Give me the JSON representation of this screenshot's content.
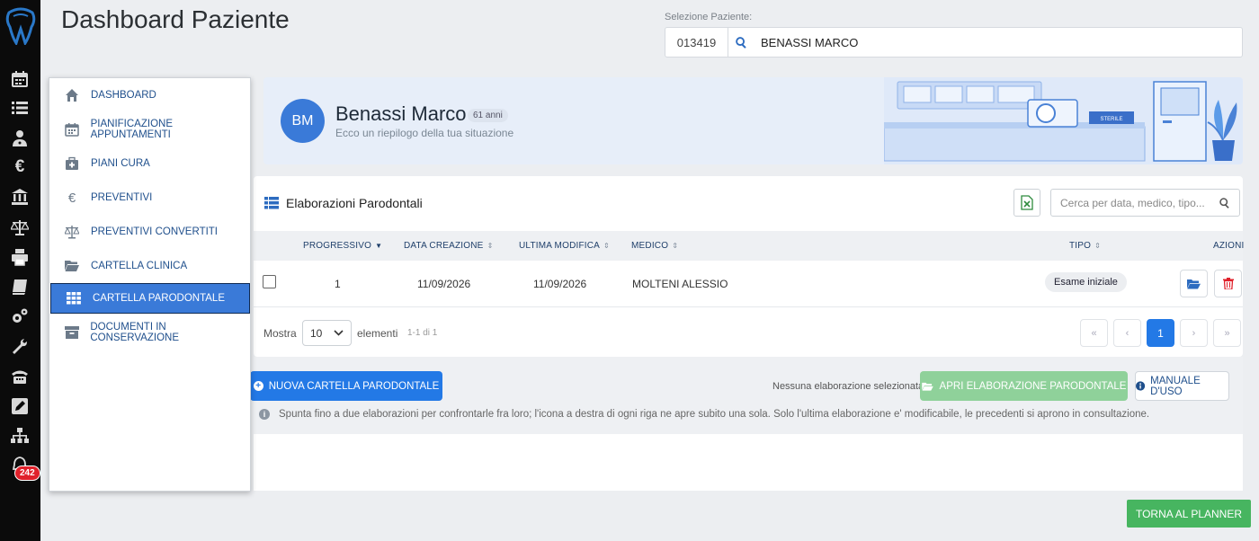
{
  "header": {
    "title": "Dashboard Paziente",
    "selection_label": "Selezione Paziente:",
    "patient_code": "013419",
    "patient_name": "BENASSI MARCO"
  },
  "sidebar": {
    "notification_count": "242"
  },
  "menu": {
    "items": [
      {
        "label": "DASHBOARD",
        "icon": "home-icon"
      },
      {
        "label": "PIANIFICAZIONE APPUNTAMENTI",
        "icon": "calendar-icon"
      },
      {
        "label": "PIANI CURA",
        "icon": "medical-kit-icon"
      },
      {
        "label": "PREVENTIVI",
        "icon": "euro-icon"
      },
      {
        "label": "PREVENTIVI CONVERTITI",
        "icon": "balance-scale-icon"
      },
      {
        "label": "CARTELLA CLINICA",
        "icon": "folder-open-icon"
      },
      {
        "label": "CARTELLA PARODONTALE",
        "icon": "grid-icon",
        "active": true
      },
      {
        "label": "DOCUMENTI IN CONSERVAZIONE",
        "icon": "archive-icon"
      }
    ]
  },
  "banner": {
    "initials": "BM",
    "name": "Benassi Marco",
    "age": "61 anni",
    "subtitle": "Ecco un riepilogo della tua situazione"
  },
  "table": {
    "title": "Elaborazioni Parodontali",
    "search_placeholder": "Cerca per data, medico, tipo...",
    "columns": [
      "PROGRESSIVO",
      "DATA CREAZIONE",
      "ULTIMA MODIFICA",
      "MEDICO",
      "TIPO",
      "AZIONI"
    ],
    "rows": [
      {
        "progressivo": "1",
        "data_creazione": "11/09/2026",
        "ultima_modifica": "11/09/2026",
        "medico": "MOLTENI ALESSIO",
        "tipo": "Esame iniziale"
      }
    ],
    "show_label": "Mostra",
    "page_size": "10",
    "elements_label": "elementi",
    "count_info": "1-1 di 1",
    "pagination": {
      "first": "«",
      "prev": "‹",
      "current": "1",
      "next": "›",
      "last": "»"
    }
  },
  "actions": {
    "new_label": "NUOVA CARTELLA PARODONTALE",
    "no_selection": "Nessuna elaborazione selezionata",
    "open_label": "APRI ELABORAZIONE PARODONTALE",
    "manual_label": "MANUALE D'USO",
    "hint": "Spunta fino a due elaborazioni per confrontarle fra loro; l'icona a destra di ogni riga ne apre subito una sola. Solo l'ultima elaborazione e' modificabile, le precedenti si aprono in consultazione.",
    "back_label": "TORNA AL PLANNER"
  },
  "colors": {
    "primary": "#2379e6",
    "success": "#47b560",
    "success_disabled": "#8fd19a",
    "danger": "#e0212b",
    "rail": "#0b0b0b"
  }
}
